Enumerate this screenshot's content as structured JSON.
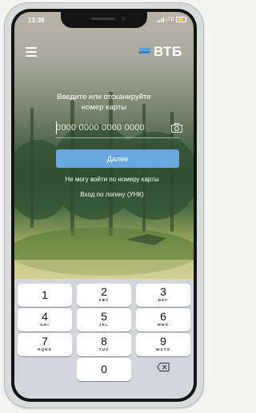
{
  "status_bar": {
    "time": "13:39",
    "carrier": "LTE"
  },
  "header": {
    "logo_text": "ВТБ",
    "menu_icon": "hamburger-menu-icon"
  },
  "main": {
    "prompt_line1": "Введите или отсканируйте",
    "prompt_line2": "номер карты",
    "card_placeholder": "0000 0000 0000 0000",
    "next_label": "Далее",
    "cannot_login_label": "Не могу войти по номеру карты",
    "login_by_login_label": "Вход по логину (УНК)"
  },
  "keypad": {
    "keys": [
      {
        "digit": "1",
        "letters": ""
      },
      {
        "digit": "2",
        "letters": "ABC"
      },
      {
        "digit": "3",
        "letters": "DEF"
      },
      {
        "digit": "4",
        "letters": "GHI"
      },
      {
        "digit": "5",
        "letters": "JKL"
      },
      {
        "digit": "6",
        "letters": "MNO"
      },
      {
        "digit": "7",
        "letters": "PQRS"
      },
      {
        "digit": "8",
        "letters": "TUV"
      },
      {
        "digit": "9",
        "letters": "WXYZ"
      },
      {
        "digit": "0",
        "letters": ""
      }
    ]
  },
  "colors": {
    "button_blue": "#6aa6df",
    "keypad_bg": "#d2d5db",
    "key_bg": "#fefefe"
  }
}
